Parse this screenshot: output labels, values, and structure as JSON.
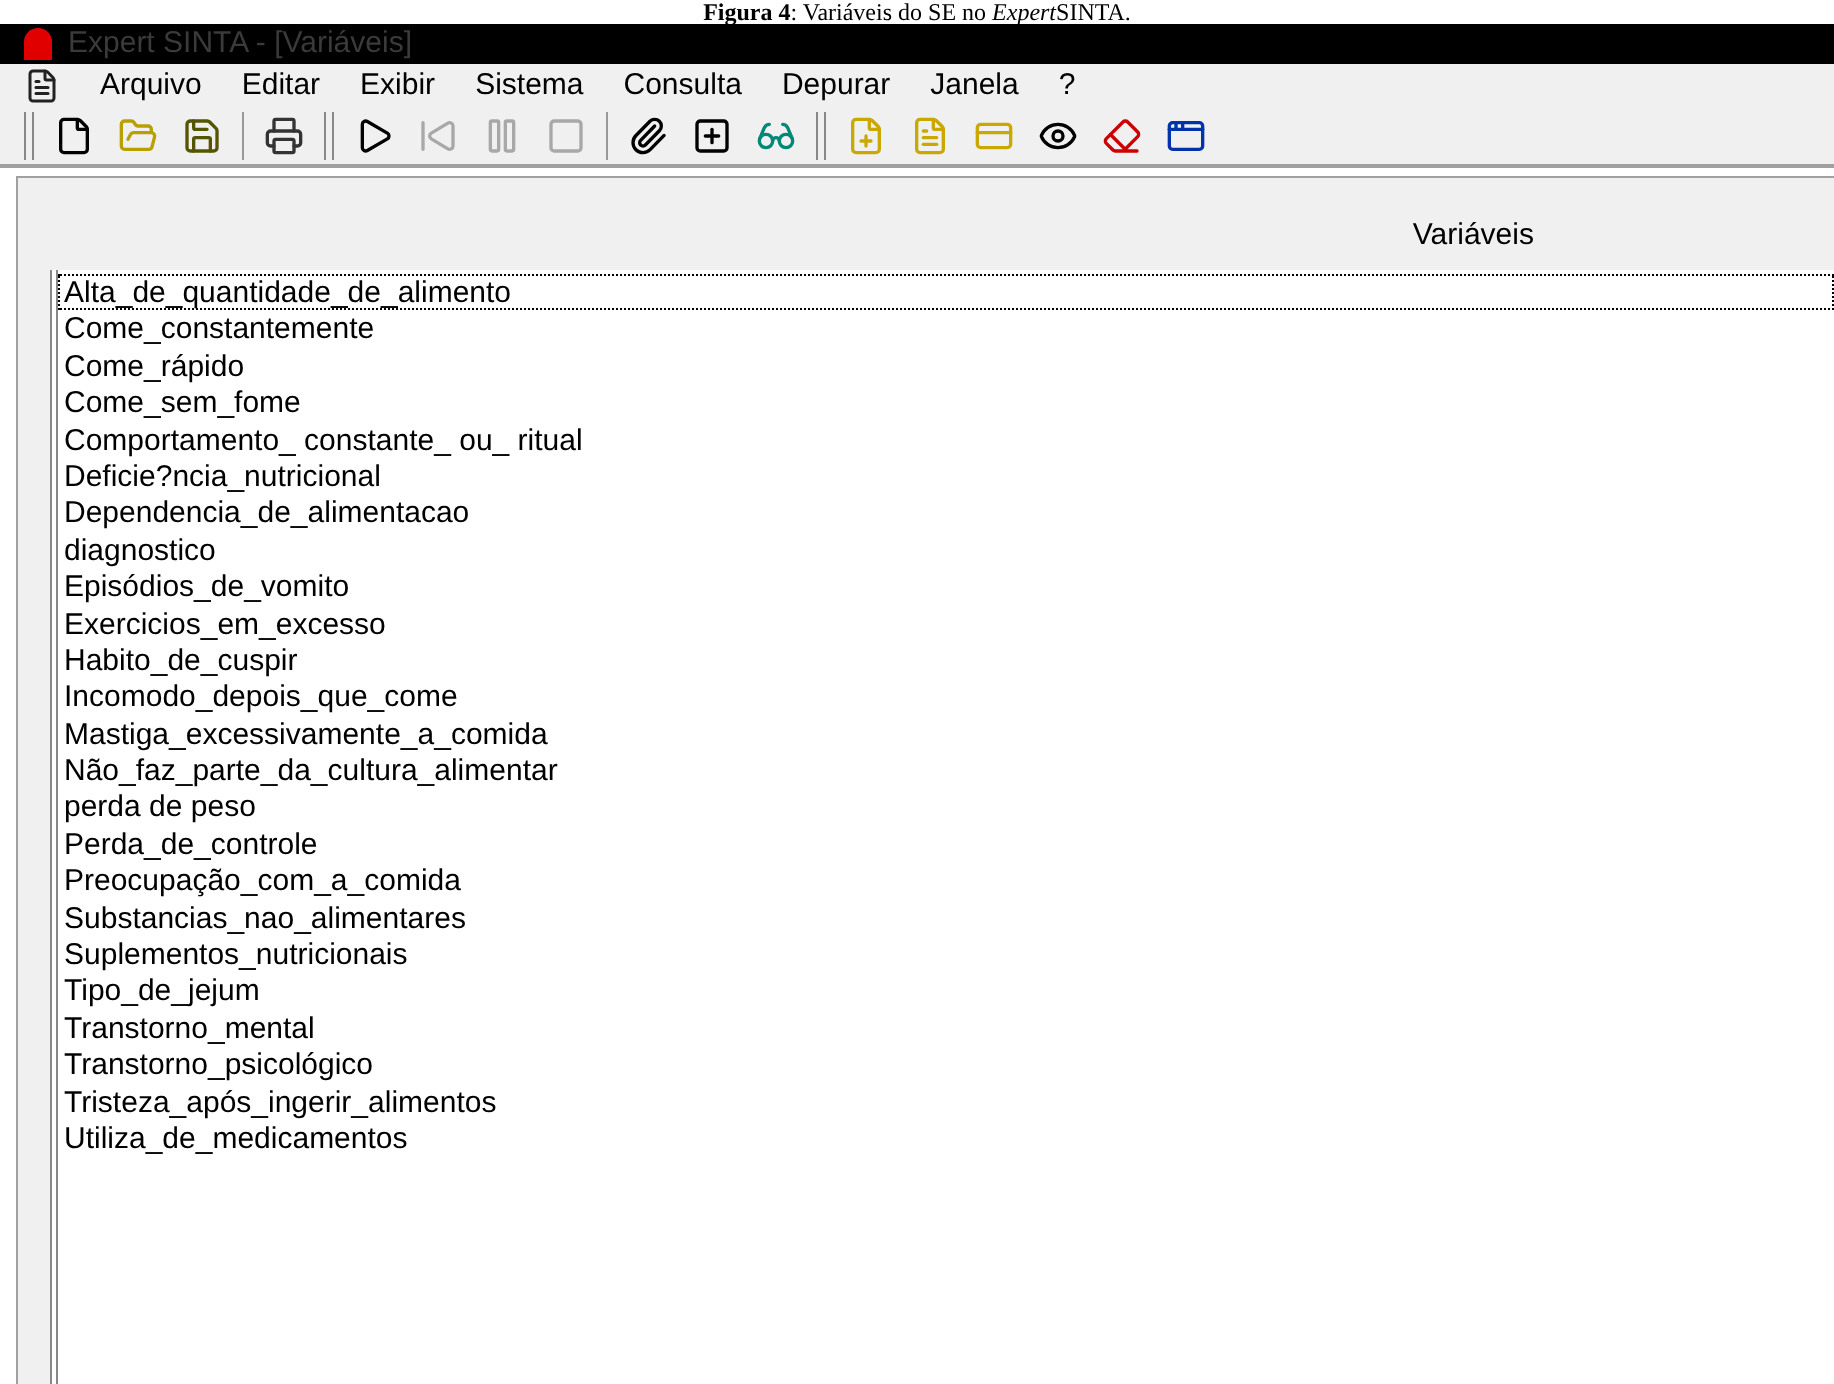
{
  "caption": {
    "label": "Figura 4",
    "text": ": Variáveis do SE no ",
    "emphasis": "Expert",
    "rest": "SINTA."
  },
  "window": {
    "title": "Expert SINTA - [Variáveis]"
  },
  "menu": [
    "Arquivo",
    "Editar",
    "Exibir",
    "Sistema",
    "Consulta",
    "Depurar",
    "Janela",
    "?"
  ],
  "toolbar": [
    {
      "kind": "grip"
    },
    {
      "kind": "new",
      "disabled": false
    },
    {
      "kind": "open",
      "disabled": false
    },
    {
      "kind": "save",
      "disabled": false
    },
    {
      "kind": "separator"
    },
    {
      "kind": "print",
      "disabled": false
    },
    {
      "kind": "grip"
    },
    {
      "kind": "run",
      "disabled": false
    },
    {
      "kind": "back",
      "disabled": true
    },
    {
      "kind": "pause",
      "disabled": true
    },
    {
      "kind": "stop",
      "disabled": true
    },
    {
      "kind": "separator"
    },
    {
      "kind": "trace",
      "disabled": false
    },
    {
      "kind": "expand",
      "disabled": false
    },
    {
      "kind": "glasses",
      "disabled": false
    },
    {
      "kind": "grip"
    },
    {
      "kind": "new-star",
      "disabled": false
    },
    {
      "kind": "doc-star",
      "disabled": false
    },
    {
      "kind": "card-star",
      "disabled": false
    },
    {
      "kind": "eye",
      "disabled": false
    },
    {
      "kind": "eraser",
      "disabled": false
    },
    {
      "kind": "windows",
      "disabled": false
    }
  ],
  "panel": {
    "header": "Variáveis"
  },
  "variables": [
    {
      "name": "Alta_de_quantidade_de_alimento",
      "selected": true
    },
    {
      "name": "Come_constantemente",
      "selected": false
    },
    {
      "name": "Come_rápido",
      "selected": false
    },
    {
      "name": "Come_sem_fome",
      "selected": false
    },
    {
      "name": "Comportamento_ constante_ ou_ ritual",
      "selected": false
    },
    {
      "name": "Deficie?ncia_nutricional",
      "selected": false
    },
    {
      "name": "Dependencia_de_alimentacao",
      "selected": false
    },
    {
      "name": "diagnostico",
      "selected": false
    },
    {
      "name": "Episódios_de_vomito",
      "selected": false
    },
    {
      "name": "Exercicios_em_excesso",
      "selected": false
    },
    {
      "name": "Habito_de_cuspir",
      "selected": false
    },
    {
      "name": "Incomodo_depois_que_come",
      "selected": false
    },
    {
      "name": "Mastiga_excessivamente_a_comida",
      "selected": false
    },
    {
      "name": "Não_faz_parte_da_cultura_alimentar",
      "selected": false
    },
    {
      "name": "perda de peso",
      "selected": false
    },
    {
      "name": "Perda_de_controle",
      "selected": false
    },
    {
      "name": "Preocupação_com_a_comida",
      "selected": false
    },
    {
      "name": "Substancias_nao_alimentares",
      "selected": false
    },
    {
      "name": "Suplementos_nutricionais",
      "selected": false
    },
    {
      "name": "Tipo_de_jejum",
      "selected": false
    },
    {
      "name": "Transtorno_mental",
      "selected": false
    },
    {
      "name": "Transtorno_psicológico",
      "selected": false
    },
    {
      "name": "Tristeza_após_ingerir_alimentos",
      "selected": false
    },
    {
      "name": "Utiliza_de_medicamentos",
      "selected": false
    }
  ]
}
